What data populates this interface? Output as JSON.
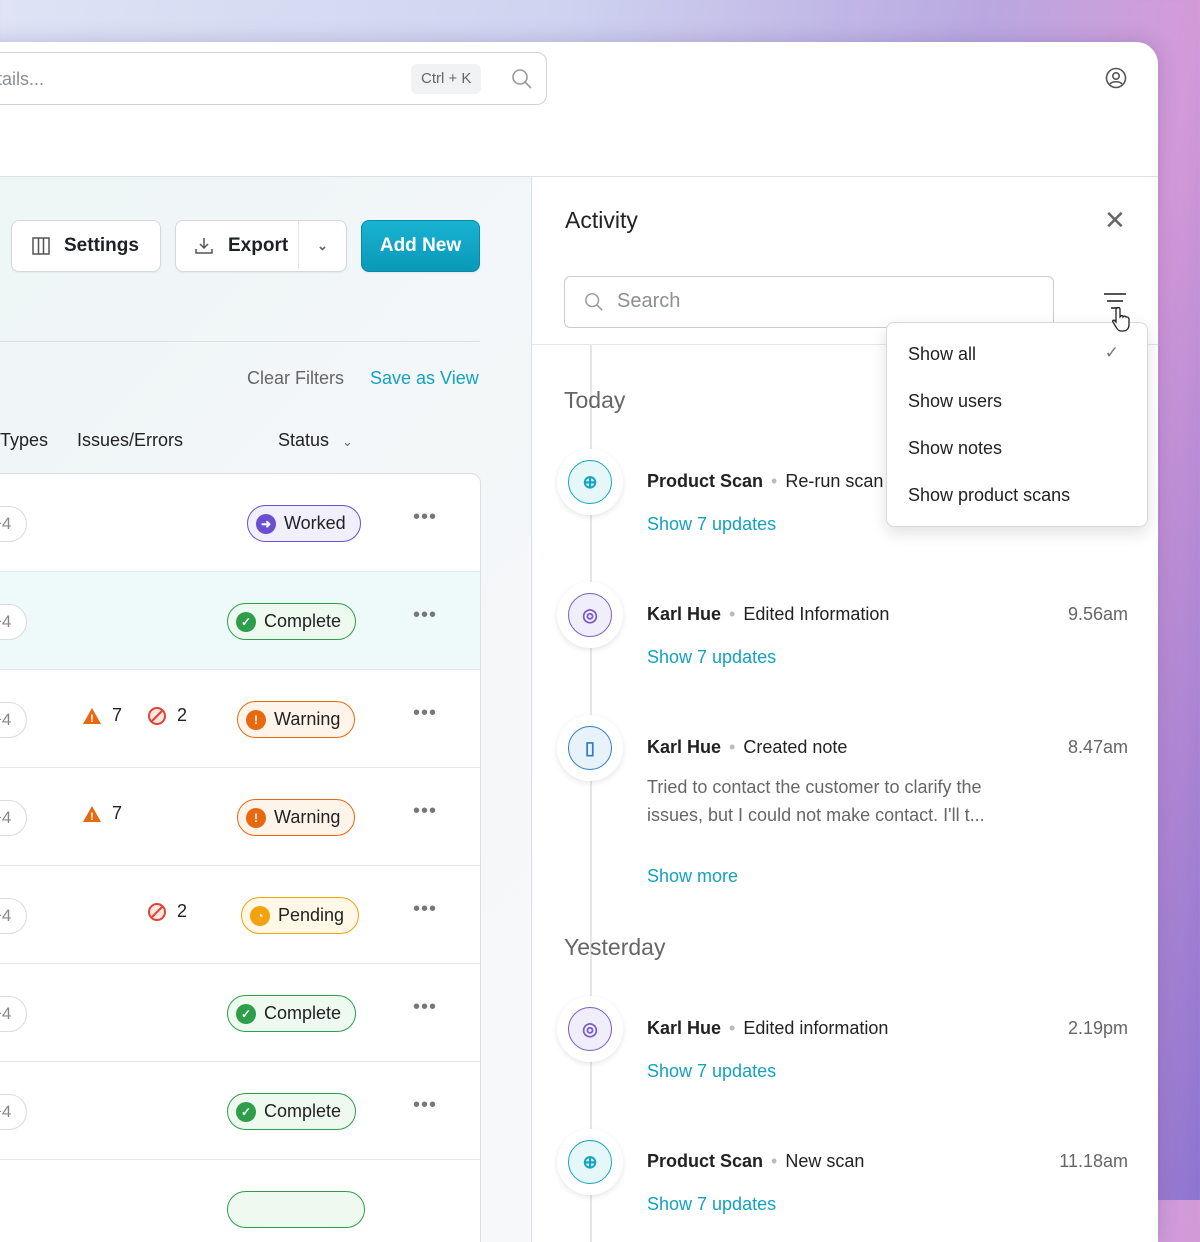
{
  "header": {
    "search_placeholder": "tails...",
    "shortcut": "Ctrl + K"
  },
  "toolbar": {
    "settings": "Settings",
    "export": "Export",
    "add_new": "Add New"
  },
  "filters": {
    "clear": "Clear Filters",
    "save_view": "Save as View"
  },
  "table": {
    "columns": [
      "Types",
      "Issues/Errors",
      "Status"
    ],
    "rows": [
      {
        "types": "+4",
        "warnings": "",
        "errors": "",
        "status": "Worked"
      },
      {
        "types": "+4",
        "warnings": "",
        "errors": "",
        "status": "Complete"
      },
      {
        "types": "+4",
        "warnings": "7",
        "errors": "2",
        "status": "Warning"
      },
      {
        "types": "+4",
        "warnings": "7",
        "errors": "",
        "status": "Warning"
      },
      {
        "types": "+4",
        "warnings": "",
        "errors": "2",
        "status": "Pending"
      },
      {
        "types": "+4",
        "warnings": "",
        "errors": "",
        "status": "Complete"
      },
      {
        "types": "+4",
        "warnings": "",
        "errors": "",
        "status": "Complete"
      },
      {
        "types": "",
        "warnings": "",
        "errors": "",
        "status": ""
      }
    ]
  },
  "status_colors": {
    "Worked": "#6b4fd0",
    "Complete": "#2e9e4a",
    "Warning": "#e8680f",
    "Pending": "#f2a20c"
  },
  "activity": {
    "title": "Activity",
    "search_placeholder": "Search",
    "groups": [
      {
        "label": "Today",
        "items": [
          {
            "icon": "scan-icon",
            "name": "Product Scan",
            "action": "Re-run scan",
            "time": "",
            "link": "Show 7 updates"
          },
          {
            "icon": "user-icon",
            "name": "Karl Hue",
            "action": "Edited Information",
            "time": "9.56am",
            "link": "Show 7 updates"
          },
          {
            "icon": "note-icon",
            "name": "Karl Hue",
            "action": "Created note",
            "time": "8.47am",
            "note": "Tried to contact the customer to clarify the issues, but I could not make contact. I'll t...",
            "link": "Show more"
          }
        ]
      },
      {
        "label": "Yesterday",
        "items": [
          {
            "icon": "user-icon",
            "name": "Karl Hue",
            "action": "Edited information",
            "time": "2.19pm",
            "link": "Show 7 updates"
          },
          {
            "icon": "scan-icon",
            "name": "Product Scan",
            "action": "New scan",
            "time": "11.18am",
            "link": "Show 7 updates"
          }
        ]
      }
    ]
  },
  "filter_menu": {
    "items": [
      "Show all",
      "Show users",
      "Show notes",
      "Show product scans"
    ],
    "selected": "Show all"
  }
}
